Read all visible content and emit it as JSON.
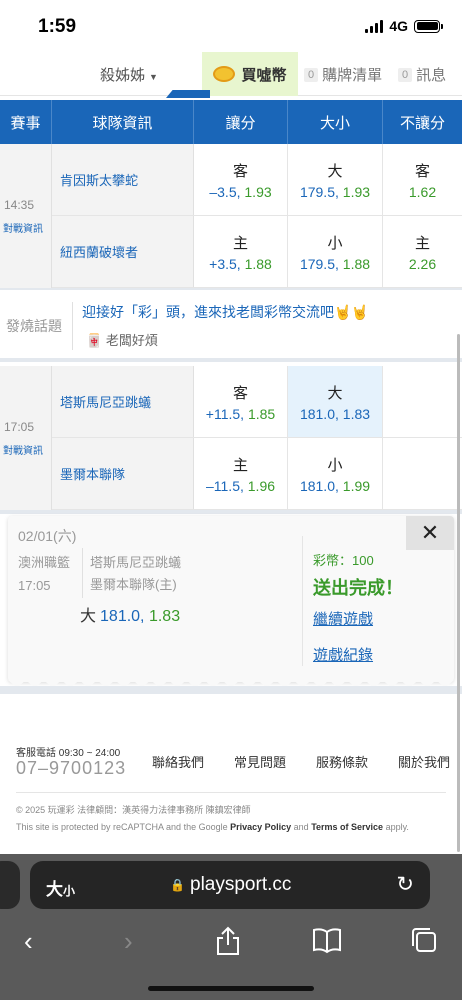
{
  "status": {
    "time": "1:59",
    "network": "4G"
  },
  "nav": {
    "user": "殺姊姊",
    "buy": "買噓幣",
    "cart_count": "0",
    "cart": "購牌清單",
    "msg_count": "0",
    "msg": "訊息"
  },
  "table": {
    "headers": [
      "賽事",
      "球隊資訊",
      "讓分",
      "大小",
      "不讓分"
    ],
    "games": [
      {
        "time": "14:35",
        "link": "對戰資訊",
        "rows": [
          {
            "team": "肯因斯太攀蛇",
            "spread_k": "客",
            "spread_line": "–3.5,",
            "spread_odds": "1.93",
            "total_k": "大",
            "total_line": "179.5,",
            "total_odds": "1.93",
            "ml_k": "客",
            "ml_odds": "1.62"
          },
          {
            "team": "紐西蘭破壞者",
            "spread_k": "主",
            "spread_line": "+3.5,",
            "spread_odds": "1.88",
            "total_k": "小",
            "total_line": "179.5,",
            "total_odds": "1.88",
            "ml_k": "主",
            "ml_odds": "2.26"
          }
        ]
      },
      {
        "time": "17:05",
        "link": "對戰資訊",
        "rows": [
          {
            "team": "塔斯馬尼亞跳蟻",
            "spread_k": "客",
            "spread_line": "+11.5,",
            "spread_odds": "1.85",
            "total_k": "大",
            "total_line": "181.0,",
            "total_odds": "1.83"
          },
          {
            "team": "墨爾本聯隊",
            "spread_k": "主",
            "spread_line": "–11.5,",
            "spread_odds": "1.96",
            "total_k": "小",
            "total_line": "181.0,",
            "total_odds": "1.99"
          }
        ]
      }
    ]
  },
  "chat": {
    "label": "發燒話題",
    "title": "迎接好「彩」頭，進來找老闆彩幣交流吧",
    "emoji": "🤘🤘",
    "sub_icon": "🀄",
    "sub": "老闆好煩"
  },
  "popup": {
    "date": "02/01(六)",
    "league": "澳洲職籃",
    "time": "17:05",
    "away": "塔斯馬尼亞跳蟻",
    "home": "墨爾本聯隊(主)",
    "pick_k": "大",
    "pick_line": "181.0,",
    "pick_odds": "1.83",
    "coins": "彩幣：100",
    "done": "送出完成！",
    "continue": "繼續遊戲",
    "history": "遊戲紀錄",
    "close": "✕"
  },
  "footer": {
    "service_label": "客服電話 09:30 ~ 24:00",
    "service_phone": "07–9700123",
    "links": [
      "聯絡我們",
      "常見問題",
      "服務條款",
      "關於我們"
    ],
    "copyright": "© 2025 玩運彩  法律顧問：漢英得力法律事務所 陳鎮宏律師",
    "recaptcha_a": "This site is protected by reCAPTCHA and the Google ",
    "privacy": "Privacy Policy",
    "and": " and ",
    "terms": "Terms of Service",
    "apply": " apply."
  },
  "browser": {
    "text_size": "大",
    "text_size_small": "小",
    "url": "playsport.cc"
  },
  "colors": {
    "brand_blue": "#1a66b8",
    "odds_green": "#3a9a2b",
    "buy_bg": "#e8f6cf"
  }
}
